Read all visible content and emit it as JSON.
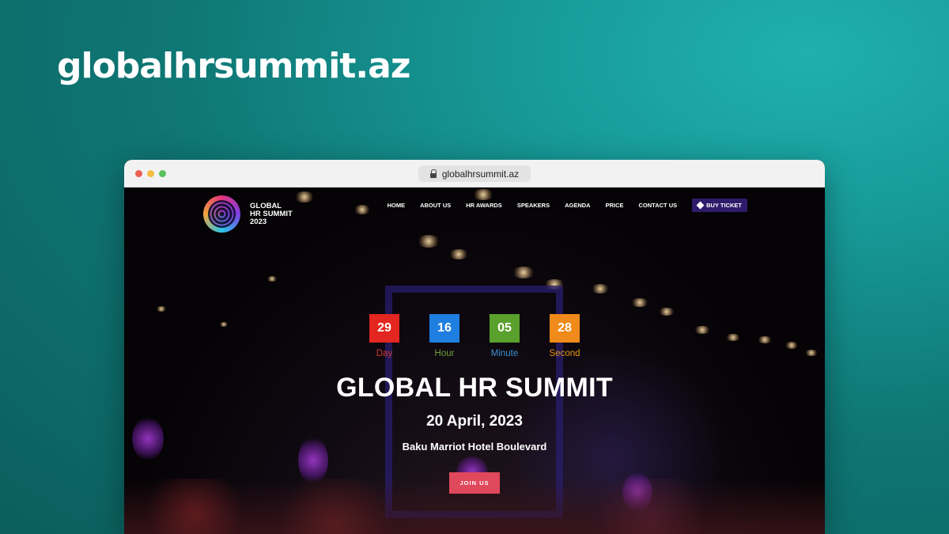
{
  "page": {
    "title": "globalhrsummit.az"
  },
  "browser": {
    "url": "globalhrsummit.az",
    "icon": "lock-icon"
  },
  "site": {
    "logo_lines": [
      "GLOBAL",
      "HR SUMMIT",
      "2023"
    ],
    "nav": [
      "HOME",
      "ABOUT US",
      "HR AWARDS",
      "SPEAKERS",
      "AGENDA",
      "PRICE",
      "CONTACT US"
    ],
    "buy_ticket": {
      "label": "BUY TICKET",
      "icon": "ticket-icon",
      "color": "#2e1b6b"
    }
  },
  "countdown": [
    {
      "value": "29",
      "label": "Day",
      "color": "#e3261f",
      "label_color": "#d23a2f"
    },
    {
      "value": "16",
      "label": "Hour",
      "color": "#1e7fe0",
      "label_color": "#6fa13a"
    },
    {
      "value": "05",
      "label": "Minute",
      "color": "#5aa02c",
      "label_color": "#3f8fd0"
    },
    {
      "value": "28",
      "label": "Second",
      "color": "#f08a1a",
      "label_color": "#e8951e"
    }
  ],
  "hero": {
    "headline": "GLOBAL HR SUMMIT",
    "date": "20 April, 2023",
    "venue": "Baku Marriot Hotel Boulevard",
    "join_button": "JOIN US",
    "join_color": "#e0485c"
  }
}
